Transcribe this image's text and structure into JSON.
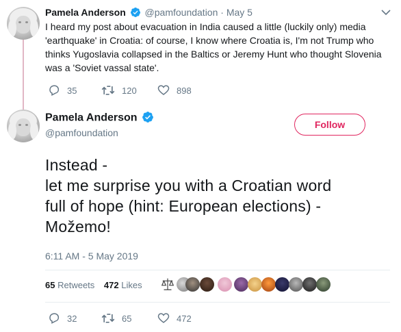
{
  "prev_tweet": {
    "name": "Pamela Anderson",
    "handle": "@pamfoundation",
    "separator": "·",
    "date": "May 5",
    "lines": [
      "I heard my post about evacuation in India caused a little (luckily only) media",
      "'earthquake' in Croatia: of course, I know where Croatia is, I'm not Trump who",
      "thinks Yugoslavia collapsed in the Baltics or Jeremy Hunt who thought Slovenia",
      "was a 'Soviet vassal state'."
    ],
    "replies": "35",
    "retweets": "120",
    "likes": "898"
  },
  "main_tweet": {
    "name": "Pamela Anderson",
    "handle": "@pamfoundation",
    "follow_label": "Follow",
    "lines": [
      "Instead -",
      "let me surprise you with a Croatian word",
      "full of hope (hint: European elections) -",
      "Možemo!"
    ],
    "timestamp": "6:11 AM - 5 May 2019",
    "retweet_count": "65",
    "retweet_label": "Retweets",
    "like_count": "472",
    "like_label": "Likes",
    "replies": "32",
    "retweets": "65",
    "likes": "472"
  },
  "colors": {
    "verified": "#1da1f2",
    "follow": "#e0245e",
    "muted": "#657786",
    "thread_line": "#e1b6c4"
  },
  "icons": [
    "verified-badge-icon",
    "chevron-down-icon",
    "reply-icon",
    "retweet-icon",
    "heart-icon"
  ]
}
